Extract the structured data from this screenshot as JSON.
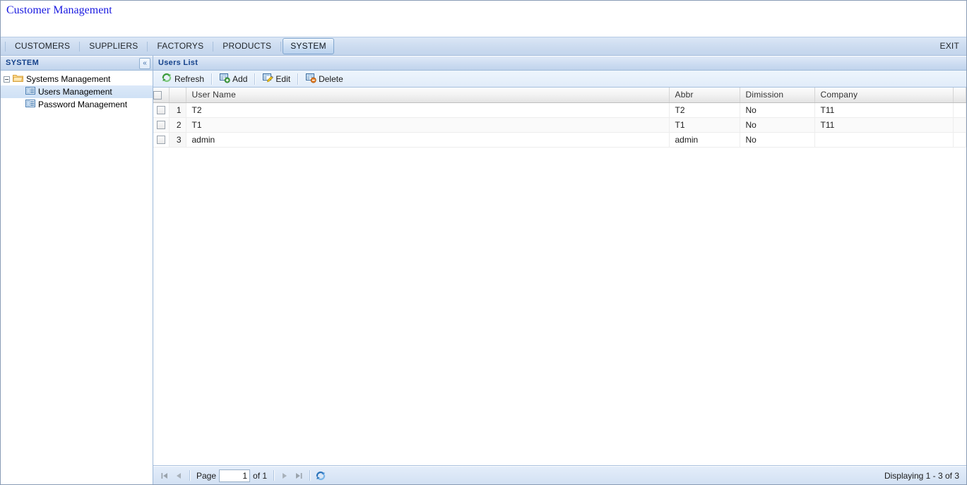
{
  "app": {
    "title": "Customer Management"
  },
  "tabs": {
    "items": [
      {
        "label": "CUSTOMERS",
        "active": false
      },
      {
        "label": "SUPPLIERS",
        "active": false
      },
      {
        "label": "FACTORYS",
        "active": false
      },
      {
        "label": "PRODUCTS",
        "active": false
      },
      {
        "label": "SYSTEM",
        "active": true
      }
    ],
    "exit_label": "EXIT"
  },
  "sidebar": {
    "header_title": "SYSTEM",
    "collapse_icon": "double-chevron-left-icon",
    "collapse_glyph": "«",
    "tree": [
      {
        "label": "Systems Management",
        "icon": "folder-icon",
        "level": 0,
        "selected": false,
        "expanded": true
      },
      {
        "label": "Users Management",
        "icon": "form-list-icon",
        "level": 1,
        "selected": true
      },
      {
        "label": "Password Management",
        "icon": "form-list-icon",
        "level": 1,
        "selected": false
      }
    ]
  },
  "main": {
    "header_title": "Users List",
    "toolbar": [
      {
        "label": "Refresh",
        "icon": "refresh-green-icon"
      },
      {
        "label": "Add",
        "icon": "table-add-icon"
      },
      {
        "label": "Edit",
        "icon": "table-edit-icon"
      },
      {
        "label": "Delete",
        "icon": "table-delete-icon"
      }
    ],
    "grid": {
      "columns": [
        "User Name",
        "Abbr",
        "Dimission",
        "Company"
      ],
      "rows": [
        {
          "num": "1",
          "user_name": "T2",
          "abbr": "T2",
          "dimission": "No",
          "company": "T11"
        },
        {
          "num": "2",
          "user_name": "T1",
          "abbr": "T1",
          "dimission": "No",
          "company": "T11"
        },
        {
          "num": "3",
          "user_name": "admin",
          "abbr": "admin",
          "dimission": "No",
          "company": ""
        }
      ]
    },
    "pager": {
      "first_icon": "first-page-icon",
      "prev_icon": "prev-page-icon",
      "next_icon": "next-page-icon",
      "last_icon": "last-page-icon",
      "refresh_icon": "refresh-blue-icon",
      "page_label": "Page",
      "page_value": "1",
      "of_label": "of 1",
      "status": "Displaying 1 - 3 of 3"
    }
  },
  "colors": {
    "title_blue": "#1a1ae0",
    "panel_title_blue": "#15428b",
    "header_gradient_top": "#dfe9f7",
    "header_gradient_bottom": "#c0d3ec",
    "selection_blue": "#cfe1f5"
  }
}
